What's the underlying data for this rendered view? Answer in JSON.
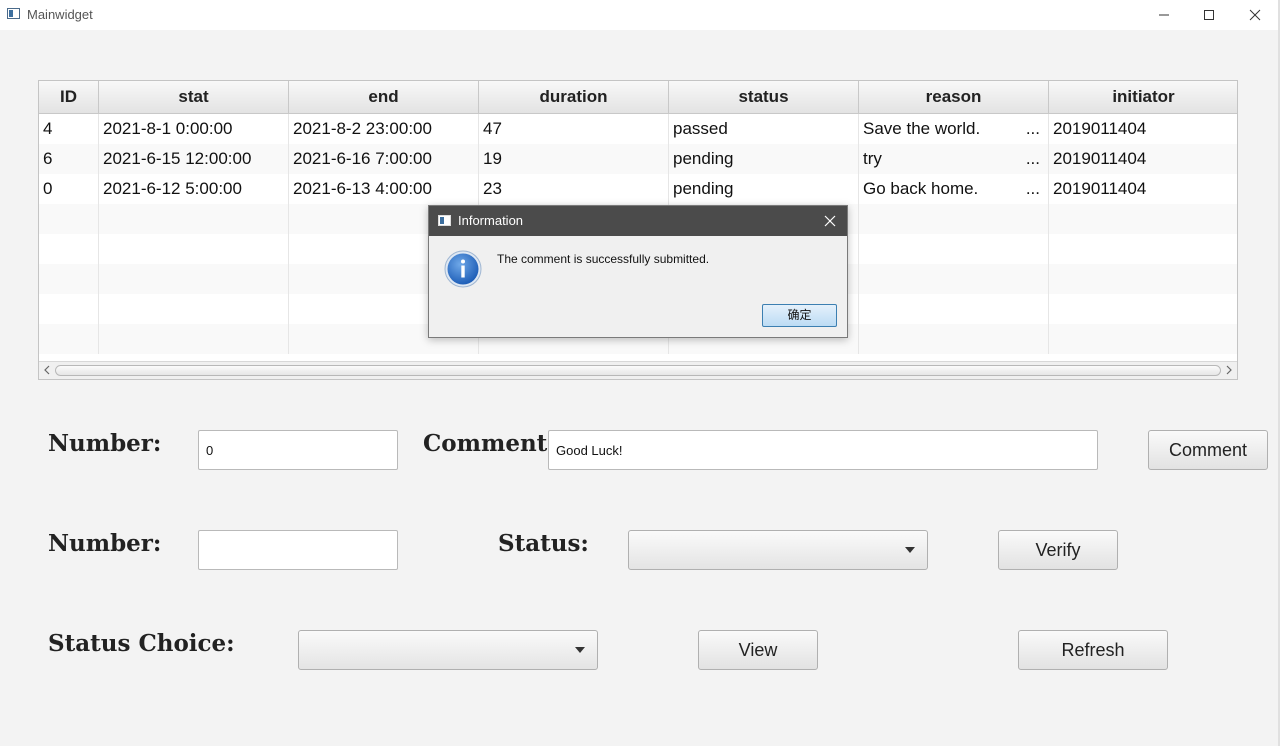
{
  "window": {
    "title": "Mainwidget"
  },
  "table": {
    "columns": [
      "ID",
      "stat",
      "end",
      "duration",
      "status",
      "reason",
      "initiator"
    ],
    "rows": [
      {
        "id": "4",
        "stat": "2021-8-1 0:00:00",
        "end": "2021-8-2 23:00:00",
        "duration": "47",
        "status": "passed",
        "reason": "Save the world.",
        "initiator": "2019011404"
      },
      {
        "id": "6",
        "stat": "2021-6-15 12:00:00",
        "end": "2021-6-16 7:00:00",
        "duration": "19",
        "status": "pending",
        "reason": "try",
        "initiator": "2019011404"
      },
      {
        "id": "0",
        "stat": "2021-6-12 5:00:00",
        "end": "2021-6-13 4:00:00",
        "duration": "23",
        "status": "pending",
        "reason": "Go back home.",
        "initiator": "2019011404"
      }
    ],
    "ellipsis": "..."
  },
  "form": {
    "number_label": "Number:",
    "number_value": "0",
    "comment_label": "Comment:",
    "comment_value": "Good Luck!",
    "comment_button": "Comment",
    "number2_label": "Number:",
    "number2_value": "",
    "status_label": "Status:",
    "status_value": "",
    "verify_button": "Verify",
    "status_choice_label": "Status Choice:",
    "status_choice_value": "",
    "view_button": "View",
    "refresh_button": "Refresh"
  },
  "dialog": {
    "title": "Information",
    "message": "The comment is successfully submitted.",
    "ok_button": "确定",
    "icon": "info-icon"
  }
}
